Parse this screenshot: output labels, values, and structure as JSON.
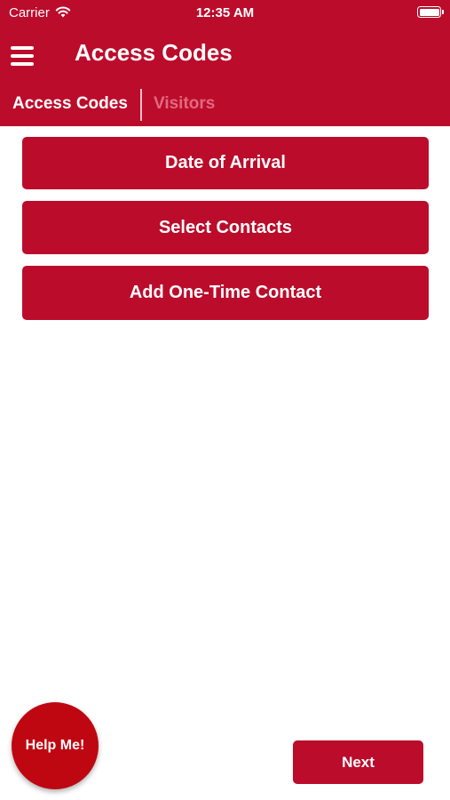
{
  "status_bar": {
    "carrier": "Carrier",
    "time": "12:35 AM",
    "wifi_icon": "wifi-icon",
    "battery_icon": "battery-icon"
  },
  "nav": {
    "menu_icon": "hamburger-menu-icon",
    "title": "Access Codes"
  },
  "tabs": [
    {
      "label": "Access Codes",
      "active": true
    },
    {
      "label": "Visitors",
      "active": false
    }
  ],
  "actions": {
    "date_of_arrival": "Date of Arrival",
    "select_contacts": "Select Contacts",
    "add_one_time_contact": "Add One-Time Contact"
  },
  "help_button": "Help Me!",
  "next_button": "Next",
  "colors": {
    "brand": "#bb0c2b",
    "help_fab": "#bf0712",
    "inactive_tab": "#e2697f",
    "background": "#ffffff"
  }
}
